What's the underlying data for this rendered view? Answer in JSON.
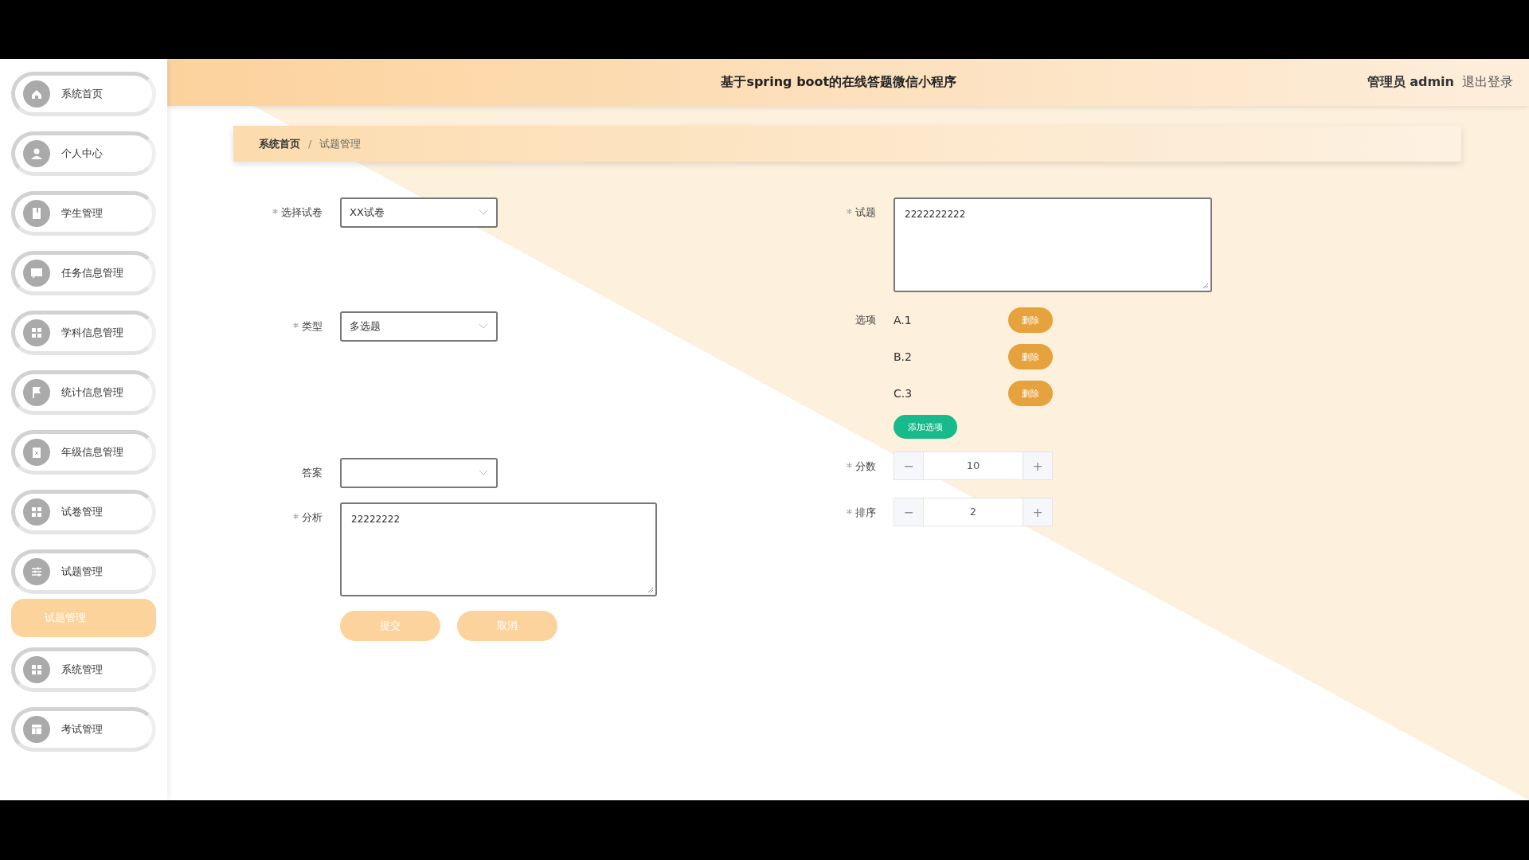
{
  "sidebar": {
    "items": [
      {
        "label": "系统首页",
        "selected": false
      },
      {
        "label": "个人中心",
        "selected": false
      },
      {
        "label": "学生管理",
        "selected": false
      },
      {
        "label": "任务信息管理",
        "selected": false
      },
      {
        "label": "学科信息管理",
        "selected": false
      },
      {
        "label": "统计信息管理",
        "selected": false
      },
      {
        "label": "年级信息管理",
        "selected": false
      },
      {
        "label": "试卷管理",
        "selected": false
      },
      {
        "label": "试题管理",
        "selected": false,
        "children": [
          {
            "label": "试题管理",
            "selected": true
          }
        ]
      },
      {
        "label": "系统管理",
        "selected": false
      },
      {
        "label": "考试管理",
        "selected": false
      }
    ]
  },
  "header": {
    "title": "基于spring boot的在线答题微信小程序",
    "user": "管理员 admin",
    "logout": "退出登录"
  },
  "breadcrumb": {
    "items": [
      "系统首页",
      "试题管理"
    ],
    "separator": "/"
  },
  "form": {
    "paper": {
      "label": "选择试卷",
      "required": true,
      "value": "XX试卷"
    },
    "type": {
      "label": "类型",
      "required": true,
      "value": "多选题"
    },
    "answer": {
      "label": "答案",
      "required": false
    },
    "analysis": {
      "label": "分析",
      "required": true,
      "value": "22222222"
    },
    "question": {
      "label": "试题",
      "required": true,
      "value": "2222222222"
    },
    "options_label": "选项",
    "options": [
      {
        "text": "A.1",
        "delete": "删除"
      },
      {
        "text": "B.2",
        "delete": "删除"
      },
      {
        "text": "C.3",
        "delete": "删除"
      }
    ],
    "add_option": "添加选项",
    "score": {
      "label": "分数",
      "required": true,
      "value": "10",
      "minus": "−",
      "plus": "+"
    },
    "order": {
      "label": "排序",
      "required": true,
      "value": "2",
      "minus": "−",
      "plus": "+"
    },
    "buttons": [
      "提交",
      "取消"
    ]
  }
}
